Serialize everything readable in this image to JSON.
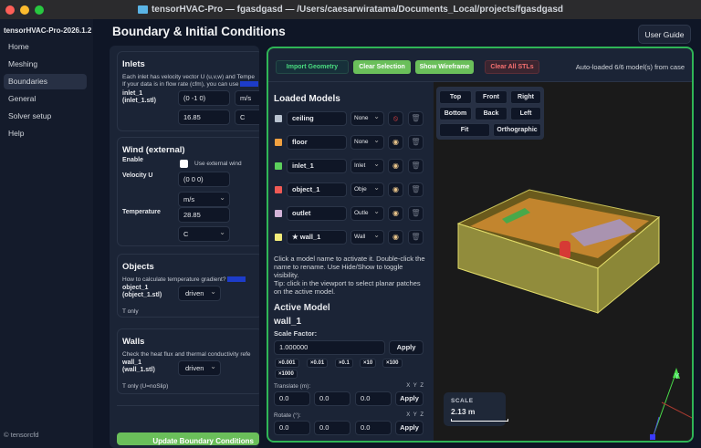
{
  "window": {
    "title": "tensorHVAC-Pro — fgasdgasd — /Users/caesarwiratama/Documents_Local/projects/fgasdgasd"
  },
  "sidebar": {
    "brand": "tensorHVAC-Pro-2026.1.2",
    "items": [
      {
        "label": "Home"
      },
      {
        "label": "Meshing"
      },
      {
        "label": "Boundaries"
      },
      {
        "label": "General"
      },
      {
        "label": "Solver setup"
      },
      {
        "label": "Help"
      }
    ],
    "footer": "© tensorcfd"
  },
  "header": {
    "title": "Boundary & Initial Conditions",
    "user_guide": "User Guide"
  },
  "inlets": {
    "title": "Inlets",
    "desc1": "Each inlet has velocity vector U (u,v,w) and Tempe",
    "desc2": "If your data is in flow rate (cfm), you can use",
    "name": "inlet_1",
    "file": "(inlet_1.stl)",
    "velocity": "(0 -1 0)",
    "vel_unit": "m/s",
    "temp": "16.85",
    "temp_unit": "C"
  },
  "wind": {
    "title": "Wind (external)",
    "enable_label": "Enable",
    "checkbox_label": "Use external wind",
    "velocity_label": "Velocity U",
    "velocity": "(0 0 0)",
    "vel_unit": "m/s",
    "temp_label": "Temperature",
    "temp": "28.85",
    "temp_unit": "C"
  },
  "objects": {
    "title": "Objects",
    "desc": "How to calculate temperature gradient?",
    "name": "object_1",
    "file": "(object_1.stl)",
    "mode": "driven",
    "note": "T only"
  },
  "walls": {
    "title": "Walls",
    "desc": "Check the heat flux and thermal conductivity refe",
    "name": "wall_1",
    "file": "(wall_1.stl)",
    "mode": "driven",
    "note": "T only (U=noSlip)"
  },
  "update_button": "Update Boundary Conditions",
  "toolbar": {
    "import": "Import Geometry",
    "clear_selection": "Clear Selection",
    "show_wireframe": "Show Wireframe",
    "clear_all": "Clear All STLs",
    "status": "Auto-loaded 6/6 model(s) from case"
  },
  "models": {
    "title": "Loaded Models",
    "items": [
      {
        "name": "ceiling",
        "type": "None",
        "color": "#b9c3d0",
        "visibility": "hidden"
      },
      {
        "name": "floor",
        "type": "None",
        "color": "#f0a040",
        "visibility": "visible"
      },
      {
        "name": "inlet_1",
        "type": "Inlet",
        "color": "#5ccf5c",
        "visibility": "visible"
      },
      {
        "name": "object_1",
        "type": "Obje",
        "color": "#ef5a55",
        "visibility": "visible"
      },
      {
        "name": "outlet",
        "type": "Outle",
        "color": "#d3b3d8",
        "visibility": "visible"
      },
      {
        "name": "★ wall_1",
        "type": "Wall",
        "color": "#f2ec7a",
        "visibility": "visible"
      }
    ],
    "help1": "Click a model name to activate it. Double-click the name to rename. Use Hide/Show to toggle visibility.",
    "help2": "Tip: click in the viewport to select planar patches on the active model."
  },
  "active": {
    "title": "Active Model",
    "name": "wall_1",
    "scale_label": "Scale Factor:",
    "scale": "1.000000",
    "apply": "Apply",
    "chips": [
      "×0.001",
      "×0.01",
      "×0.1",
      "×10",
      "×100",
      "×1000"
    ],
    "translate_label": "Translate (m):",
    "translate": [
      "0.0",
      "0.0",
      "0.0"
    ],
    "rotate_label": "Rotate (°):",
    "rotate": [
      "0.0",
      "0.0",
      "0.0"
    ],
    "axes": "X  Y  Z"
  },
  "view": {
    "buttons": [
      "Top",
      "Front",
      "Right",
      "Bottom",
      "Back",
      "Left",
      "Fit",
      "Orthographic"
    ],
    "scale_label": "SCALE",
    "scale_value": "2.13 m",
    "axis_y": "Y"
  }
}
